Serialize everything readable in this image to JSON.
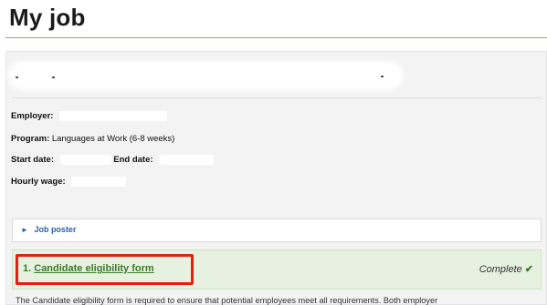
{
  "page": {
    "title": "My job"
  },
  "details": {
    "employer_label": "Employer:",
    "program_label": "Program:",
    "program_value": "Languages at Work (6-8 weeks)",
    "start_label": "Start date:",
    "end_label": "End date:",
    "wage_label": "Hourly wage:"
  },
  "job_poster": {
    "icon": "triangle-right-icon",
    "label": "Job poster"
  },
  "steps": [
    {
      "number": "1.",
      "label": "Candidate eligibility form",
      "status": "Complete",
      "status_icon": "check-icon",
      "description": "The Candidate eligibility form is required to ensure that potential employees meet all requirements. Both employer"
    }
  ],
  "colors": {
    "title_rule": "#d08080",
    "link": "#2a5fa8",
    "step_bg": "#e6f1df",
    "step_text": "#3d7a2c",
    "highlight": "#e02010"
  }
}
